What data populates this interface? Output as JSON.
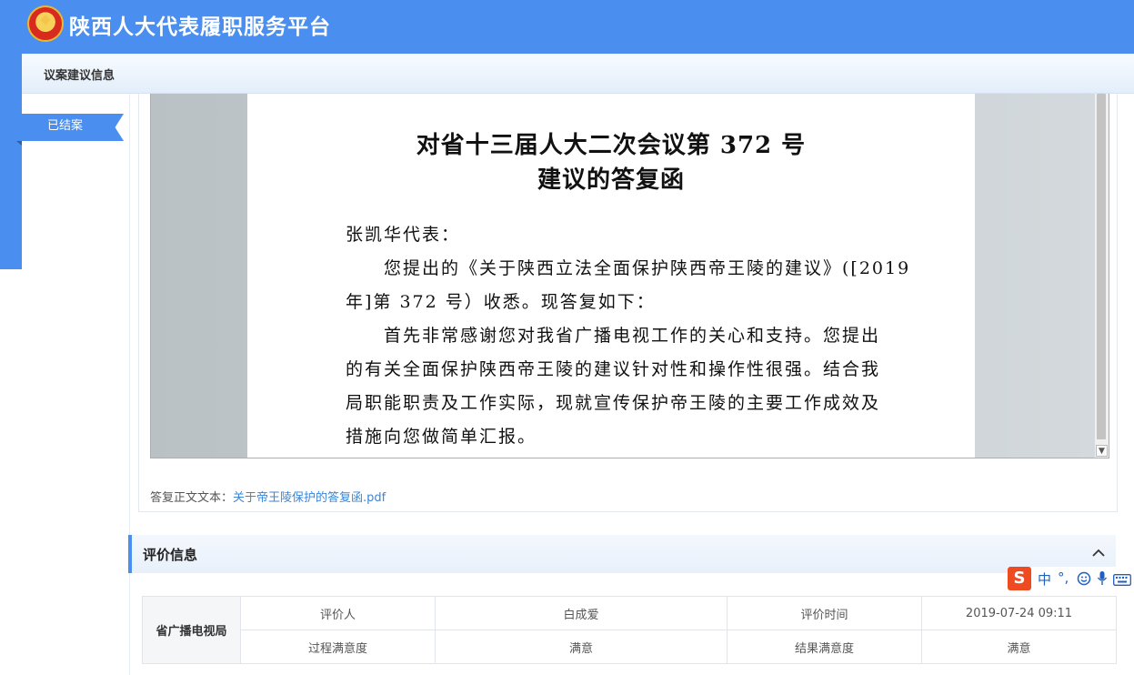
{
  "header": {
    "site_title": "陕西人大代表履职服务平台"
  },
  "subheader": {
    "title": "议案建议信息"
  },
  "status": {
    "label": "已结案"
  },
  "document": {
    "title_line1": "对省十三届人大二次会议第 372 号",
    "title_line2": "建议的答复函",
    "lines": [
      "张凯华代表：",
      "　　您提出的《关于陕西立法全面保护陕西帝王陵的建议》([2019",
      "年]第 372 号）收悉。现答复如下：",
      "　　首先非常感谢您对我省广播电视工作的关心和支持。您提出",
      "的有关全面保护陕西帝王陵的建议针对性和操作性很强。结合我",
      "局职能职责及工作实际，现就宣传保护帝王陵的主要工作成效及",
      "措施向您做简单汇报。"
    ]
  },
  "attachment": {
    "label": "答复正文文本：",
    "file_name": "关于帝王陵保护的答复函.pdf"
  },
  "evaluation": {
    "section_title": "评价信息",
    "toggle_icon": "chevron-up-icon",
    "organization": "省广播电视局",
    "rows": [
      [
        "评价人",
        "白成爱",
        "评价时间",
        "2019-07-24 09:11"
      ],
      [
        "过程满意度",
        "满意",
        "结果满意度",
        "满意"
      ]
    ]
  },
  "ime_toolbar": {
    "logo": "S",
    "mode": "中",
    "punct": "°,",
    "icons": [
      "emoji-icon",
      "microphone-icon",
      "keyboard-icon"
    ]
  },
  "colors": {
    "brand_blue": "#4a8ef0",
    "link_blue": "#3a86d8",
    "ime_red": "#ef4b21"
  }
}
